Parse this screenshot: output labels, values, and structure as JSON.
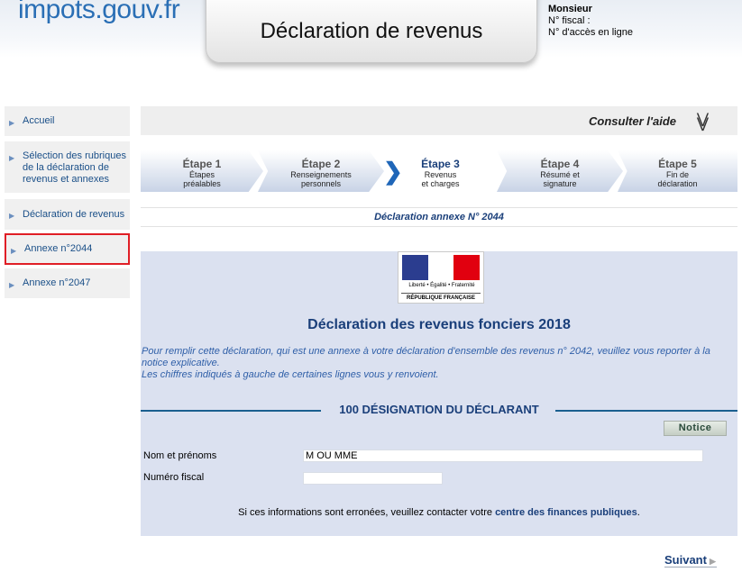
{
  "header": {
    "logo": "impots.gouv.fr",
    "title": "Déclaration de revenus",
    "user_name": "Monsieur",
    "fiscal_number_label": "N° fiscal :",
    "online_access_label": "N° d'accès en ligne"
  },
  "sidebar": {
    "items": [
      {
        "label": "Accueil"
      },
      {
        "label": "Sélection des rubriques de la déclaration de revenus et annexes"
      },
      {
        "label": "Déclaration de revenus"
      },
      {
        "label": "Annexe n°2044",
        "active": true
      },
      {
        "label": "Annexe n°2047"
      }
    ]
  },
  "help": {
    "label": "Consulter l'aide",
    "icon": "double-chevron-down-icon"
  },
  "steps": [
    {
      "title": "Étape 1",
      "desc1": "Étapes",
      "desc2": "préalables"
    },
    {
      "title": "Étape 2",
      "desc1": "Renseignements",
      "desc2": "personnels"
    },
    {
      "title": "Étape 3",
      "desc1": "Revenus",
      "desc2": "et charges",
      "current": true
    },
    {
      "title": "Étape 4",
      "desc1": "Résumé et",
      "desc2": "signature"
    },
    {
      "title": "Étape 5",
      "desc1": "Fin de",
      "desc2": "déclaration"
    }
  ],
  "annex_title": "Déclaration annexe N° 2044",
  "emblem": {
    "motto": "Liberté • Égalité • Fraternité",
    "republic": "RÉPUBLIQUE FRANÇAISE"
  },
  "main": {
    "title": "Déclaration des revenus fonciers 2018",
    "info_line1": "Pour remplir cette déclaration, qui est une annexe à votre déclaration d'ensemble des revenus n° 2042, veuillez vous reporter à la notice explicative.",
    "info_line2": "Les chiffres indiqués à gauche de certaines lignes vous y renvoient.",
    "section_title": "100 DÉSIGNATION DU DÉCLARANT",
    "notice_button": "Notice",
    "name_label": "Nom et prénoms",
    "name_value": "M OU MME",
    "fiscal_label": "Numéro fiscal",
    "fiscal_value": "",
    "contact_text": "Si ces informations sont erronées, veuillez contacter votre",
    "contact_link": "centre des finances publiques",
    "contact_end": "."
  },
  "footer": {
    "next_label": "Suivant"
  },
  "colors": {
    "accent_blue": "#1a3f7a",
    "panel_bg": "#dbe1f0",
    "active_border": "#e01e26"
  }
}
